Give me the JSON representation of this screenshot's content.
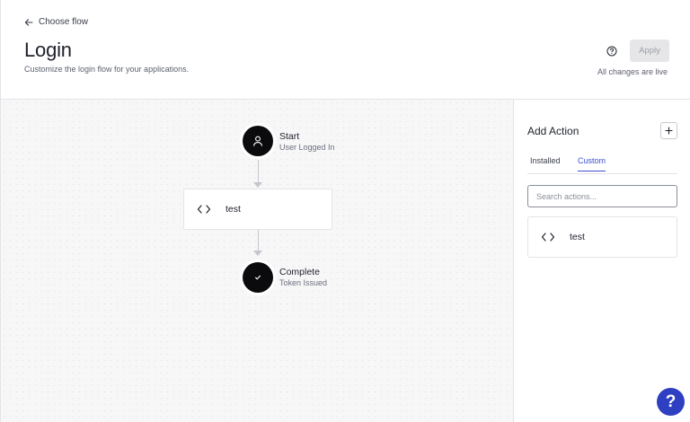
{
  "header": {
    "back_label": "Choose flow",
    "title": "Login",
    "subtitle": "Customize the login flow for your applications.",
    "apply_label": "Apply",
    "live_status": "All changes are live"
  },
  "flow": {
    "start": {
      "title": "Start",
      "subtitle": "User Logged In",
      "icon": "user-icon"
    },
    "action": {
      "label": "test",
      "icon": "code-icon"
    },
    "end": {
      "title": "Complete",
      "subtitle": "Token Issued",
      "icon": "check-icon"
    }
  },
  "panel": {
    "title": "Add Action",
    "tabs": [
      {
        "label": "Installed",
        "active": false
      },
      {
        "label": "Custom",
        "active": true
      }
    ],
    "search_placeholder": "Search actions...",
    "actions": [
      {
        "label": "test",
        "icon": "code-icon"
      }
    ]
  },
  "help_fab": {
    "label": "?",
    "icon": "question-icon"
  },
  "colors": {
    "accent": "#3a4fd6",
    "fab": "#2f3fc2",
    "node": "#0b0b0d",
    "border": "#e3e4e8"
  }
}
